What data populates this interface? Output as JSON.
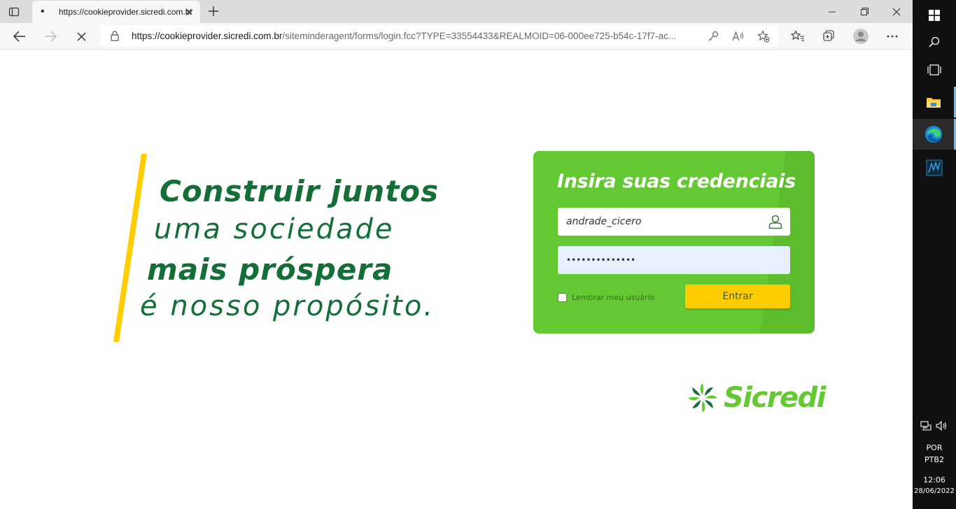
{
  "browser": {
    "tab": {
      "title": "https://cookieprovider.sicredi.com.br",
      "loading_indicator": "•"
    },
    "url_host": "https://cookieprovider.sicredi.com.br",
    "url_path": "/siteminderagent/forms/login.fcc?TYPE=33554433&REALMOID=06-000ee725-b54c-17f7-ac..."
  },
  "page": {
    "tagline": {
      "line1": "Construir juntos",
      "line2": "uma sociedade",
      "line3": "mais próspera",
      "line4": "é nosso propósito."
    },
    "login": {
      "title": "Insira suas credenciais",
      "username_value": "andrade_cicero",
      "password_value": "••••••••••••••",
      "remember_label": "Lembrar meu usuário",
      "remember_checked": false,
      "submit_label": "Entrar"
    },
    "logo": {
      "wordmark": "Sicredi"
    },
    "colors": {
      "brand_green": "#64c832",
      "dark_green": "#146e37",
      "accent_yellow": "#ffcd00"
    }
  },
  "taskbar": {
    "language_line1": "POR",
    "language_line2": "PTB2",
    "time": "12:06",
    "date": "28/06/2022",
    "icons": [
      "windows-start-icon",
      "search-icon",
      "task-view-icon",
      "file-explorer-icon",
      "edge-icon",
      "app-icon"
    ]
  }
}
